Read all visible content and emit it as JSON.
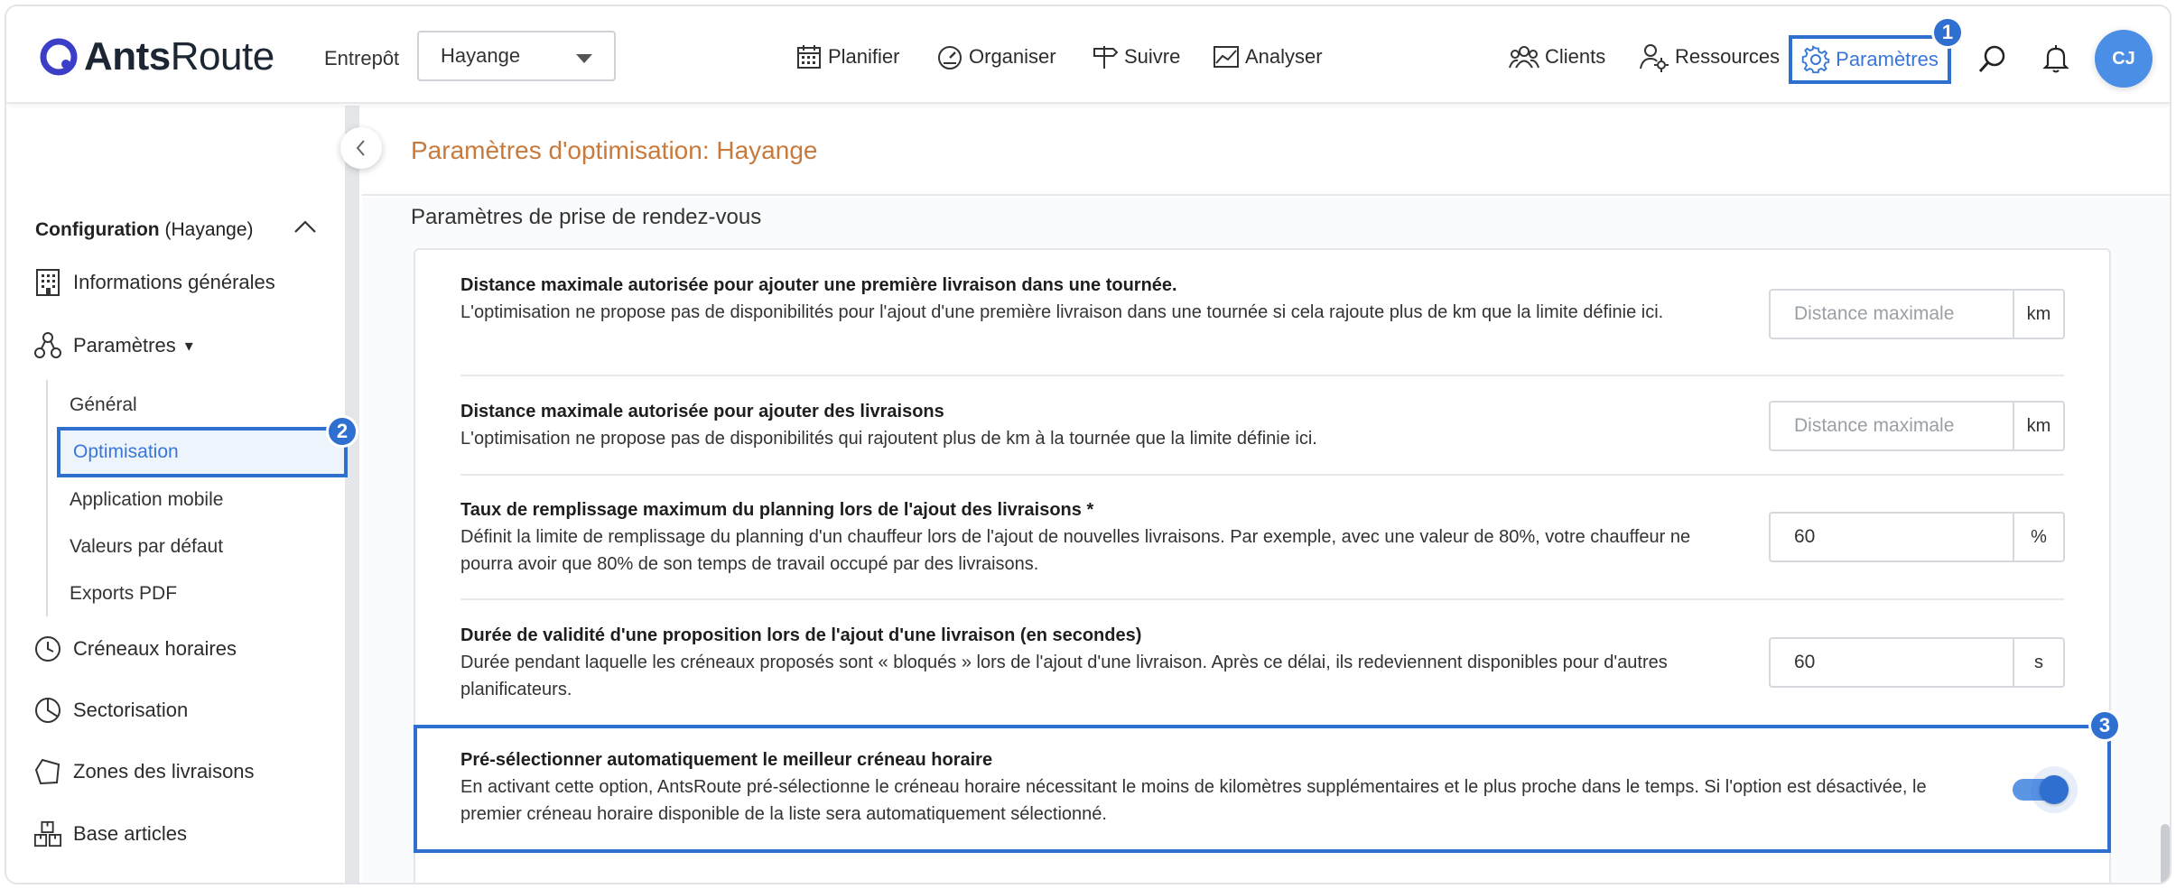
{
  "app": {
    "logo_text_bold": "Ants",
    "logo_text_light": "Route",
    "brand_color": "#3b3fc7"
  },
  "header": {
    "warehouse_label": "Entrepôt",
    "warehouse_value": "Hayange",
    "nav": [
      {
        "label": "Planifier",
        "icon": "calendar-icon"
      },
      {
        "label": "Organiser",
        "icon": "gauge-icon"
      },
      {
        "label": "Suivre",
        "icon": "signpost-icon"
      },
      {
        "label": "Analyser",
        "icon": "chart-icon"
      }
    ],
    "right_nav": [
      {
        "label": "Clients",
        "icon": "users-icon"
      },
      {
        "label": "Ressources",
        "icon": "user-gear-icon"
      },
      {
        "label": "Paramètres",
        "icon": "gear-icon",
        "active": true
      }
    ],
    "avatar_initials": "CJ",
    "accent_color": "#2f6fd0"
  },
  "badges": {
    "one": "1",
    "two": "2",
    "three": "3"
  },
  "sidebar": {
    "config_title_bold": "Configuration",
    "config_title_rest": "(Hayange)",
    "items": [
      {
        "label": "Informations générales",
        "icon": "building-icon"
      },
      {
        "label": "Paramètres",
        "icon": "settings-nodes-icon",
        "suffix": "▾"
      },
      {
        "label": "Créneaux horaires",
        "icon": "clock-icon"
      },
      {
        "label": "Sectorisation",
        "icon": "pie-icon"
      },
      {
        "label": "Zones des livraisons",
        "icon": "polygon-icon"
      },
      {
        "label": "Base articles",
        "icon": "boxes-icon"
      }
    ],
    "sub_items": [
      "Général",
      "Optimisation",
      "Application mobile",
      "Valeurs par défaut",
      "Exports PDF"
    ]
  },
  "main": {
    "title": "Paramètres d'optimisation: Hayange",
    "section_title": "Paramètres de prise de rendez-vous",
    "settings": [
      {
        "title": "Distance maximale autorisée pour ajouter une première livraison dans une tournée.",
        "description": "L'optimisation ne propose pas de disponibilités pour l'ajout d'une première livraison dans une tournée si cela rajoute plus de km que la limite définie ici.",
        "placeholder": "Distance maximale",
        "value": "",
        "unit": "km"
      },
      {
        "title": "Distance maximale autorisée pour ajouter des livraisons",
        "description": "L'optimisation ne propose pas de disponibilités qui rajoutent plus de km à la tournée que la limite définie ici.",
        "placeholder": "Distance maximale",
        "value": "",
        "unit": "km"
      },
      {
        "title": "Taux de remplissage maximum du planning lors de l'ajout des livraisons *",
        "description": "Définit la limite de remplissage du planning d'un chauffeur lors de l'ajout de nouvelles livraisons. Par exemple, avec une valeur de 80%, votre chauffeur ne pourra avoir que 80% de son temps de travail occupé par des livraisons.",
        "placeholder": "",
        "value": "60",
        "unit": "%"
      },
      {
        "title": "Durée de validité d'une proposition lors de l'ajout d'une livraison (en secondes)",
        "description": "Durée pendant laquelle les créneaux proposés sont « bloqués » lors de l'ajout d'une livraison. Après ce délai, ils redeviennent disponibles pour d'autres planificateurs.",
        "placeholder": "",
        "value": "60",
        "unit": "s"
      }
    ],
    "toggle_setting": {
      "title": "Pré-sélectionner automatiquement le meilleur créneau horaire",
      "description": "En activant cette option, AntsRoute pré-sélectionne le créneau horaire nécessitant le moins de kilomètres supplémentaires et le plus proche dans le temps. Si l'option est désactivée, le premier créneau horaire disponible de la liste sera automatiquement sélectionné.",
      "enabled": true
    }
  }
}
